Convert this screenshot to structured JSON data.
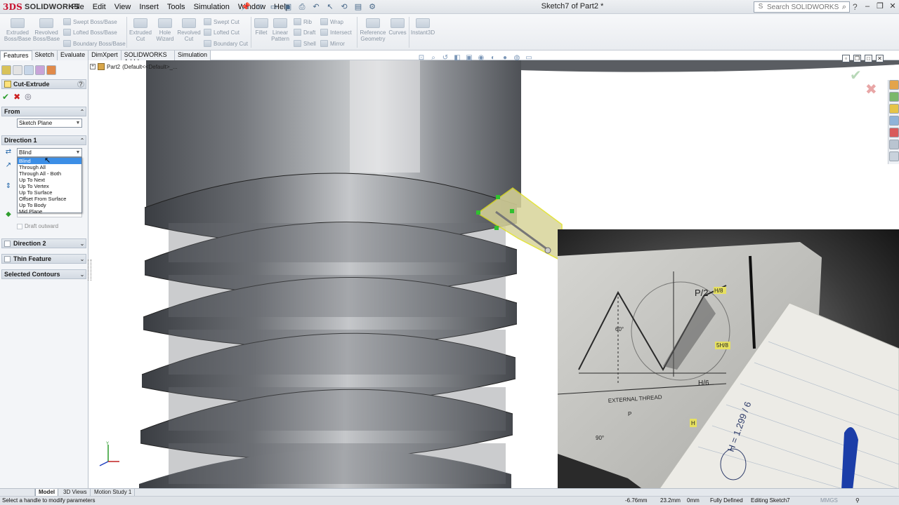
{
  "app": {
    "brand": "SOLIDWORKS",
    "brand_prefix": "3DS",
    "document_title": "Sketch7 of Part2 *"
  },
  "menu": [
    "File",
    "Edit",
    "View",
    "Insert",
    "Tools",
    "Simulation",
    "Window",
    "Help"
  ],
  "search": {
    "placeholder": "Search SOLIDWORKS Help"
  },
  "ribbon": {
    "big": [
      {
        "label": "Extruded\nBoss/Base"
      },
      {
        "label": "Revolved\nBoss/Base"
      },
      {
        "label": "Extruded\nCut"
      },
      {
        "label": "Hole\nWizard"
      },
      {
        "label": "Revolved\nCut"
      },
      {
        "label": "Fillet"
      },
      {
        "label": "Linear\nPattern"
      },
      {
        "label": "Reference\nGeometry"
      },
      {
        "label": "Curves"
      },
      {
        "label": "Instant3D"
      }
    ],
    "small": [
      "Swept Boss/Base",
      "Lofted Boss/Base",
      "Boundary Boss/Base",
      "Swept Cut",
      "Lofted Cut",
      "Boundary Cut",
      "Rib",
      "Draft",
      "Shell",
      "Wrap",
      "Intersect",
      "Mirror"
    ]
  },
  "tabs": [
    "Features",
    "Sketch",
    "Evaluate",
    "DimXpert",
    "SOLIDWORKS Add-Ins",
    "Simulation"
  ],
  "property_manager": {
    "title": "Cut-Extrude",
    "from": {
      "label": "From",
      "value": "Sketch Plane"
    },
    "direction1": {
      "label": "Direction 1",
      "end_condition": "Blind",
      "options": [
        "Blind",
        "Through All",
        "Through All - Both",
        "Up To Next",
        "Up To Vertex",
        "Up To Surface",
        "Offset From Surface",
        "Up To Body",
        "Mid Plane"
      ],
      "draft_label": "Draft outward"
    },
    "direction2": {
      "label": "Direction 2"
    },
    "thin_feature": {
      "label": "Thin Feature"
    },
    "selected_contours": {
      "label": "Selected Contours"
    }
  },
  "feature_tree": {
    "part": "Part2",
    "config": "(Default<<Default>_..."
  },
  "webcam": {
    "note_text": "H = 1.299 / 6",
    "label_external_thread": "EXTERNAL THREAD",
    "labels": [
      "H/8",
      "P/2",
      "5H/8",
      "H/6",
      "60°",
      "90°",
      "P",
      "H"
    ]
  },
  "bottom_tabs": [
    "Model",
    "3D Views",
    "Motion Study 1"
  ],
  "status": {
    "hint": "Select a handle to modify parameters",
    "x": "-6.76mm",
    "y": "23.2mm",
    "z": "0mm",
    "definition": "Fully Defined",
    "mode": "Editing Sketch7",
    "units": "MMGS"
  },
  "colors": {
    "accent_red": "#c8102e",
    "selection_blue": "#3c8ee6",
    "ok_green": "#2e9e2e",
    "cancel_red": "#cc2020",
    "preview_yellow": "#d8d49a"
  }
}
